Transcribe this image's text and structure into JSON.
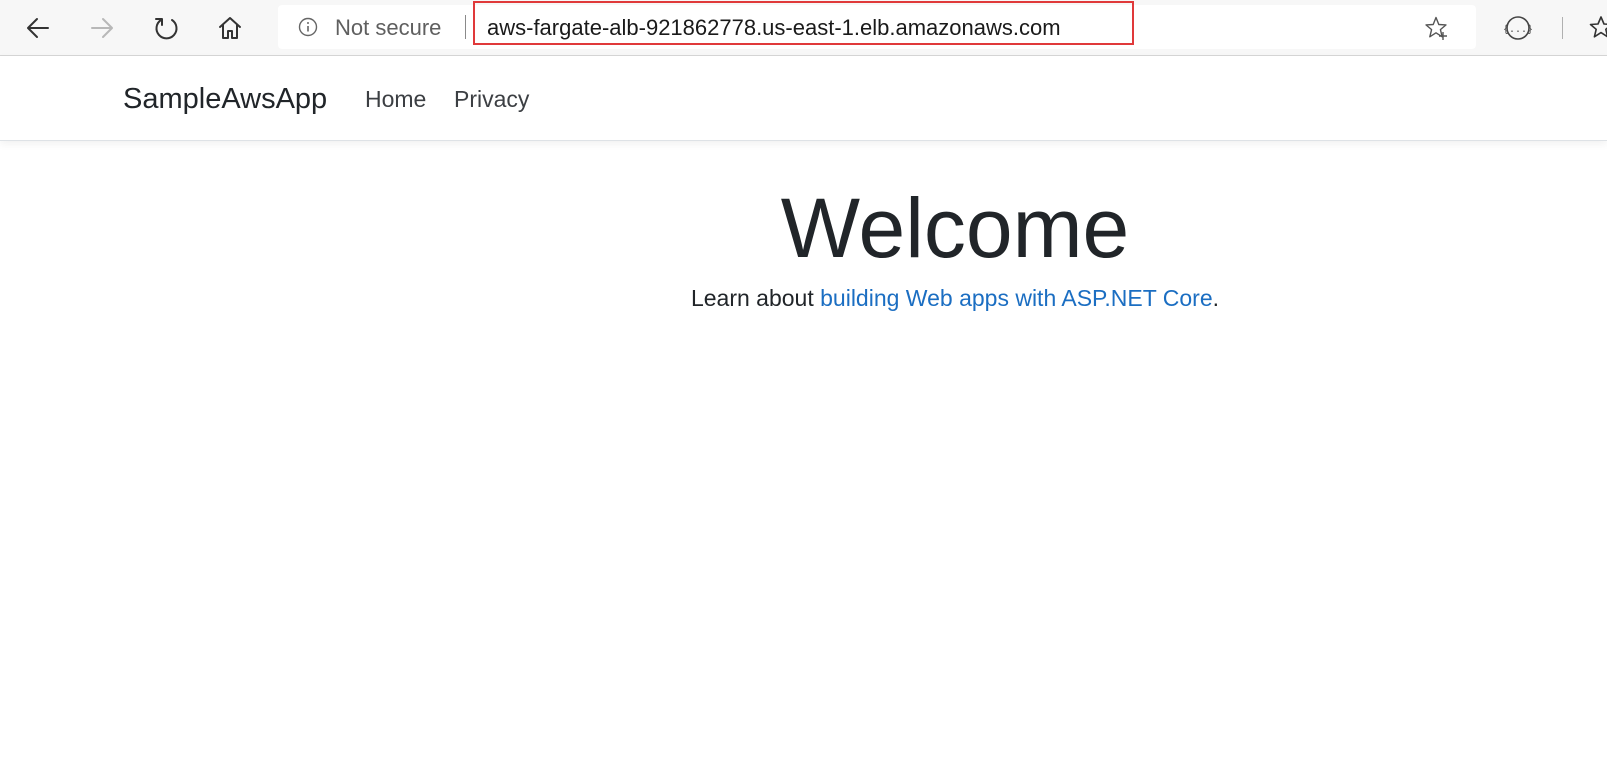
{
  "browser": {
    "back_icon": "back-arrow-icon",
    "forward_icon": "forward-arrow-icon",
    "refresh_icon": "refresh-icon",
    "home_icon": "home-icon",
    "security_label": "Not secure",
    "url": "aws-fargate-alb-921862778.us-east-1.elb.amazonaws.com",
    "highlight_color": "#e0393a"
  },
  "app": {
    "brand": "SampleAwsApp",
    "nav": [
      {
        "label": "Home"
      },
      {
        "label": "Privacy"
      }
    ]
  },
  "main": {
    "title": "Welcome",
    "learn_prefix": "Learn about ",
    "learn_link": "building Web apps with ASP.NET Core",
    "learn_suffix": ".",
    "link_color": "#1b6ec2"
  }
}
